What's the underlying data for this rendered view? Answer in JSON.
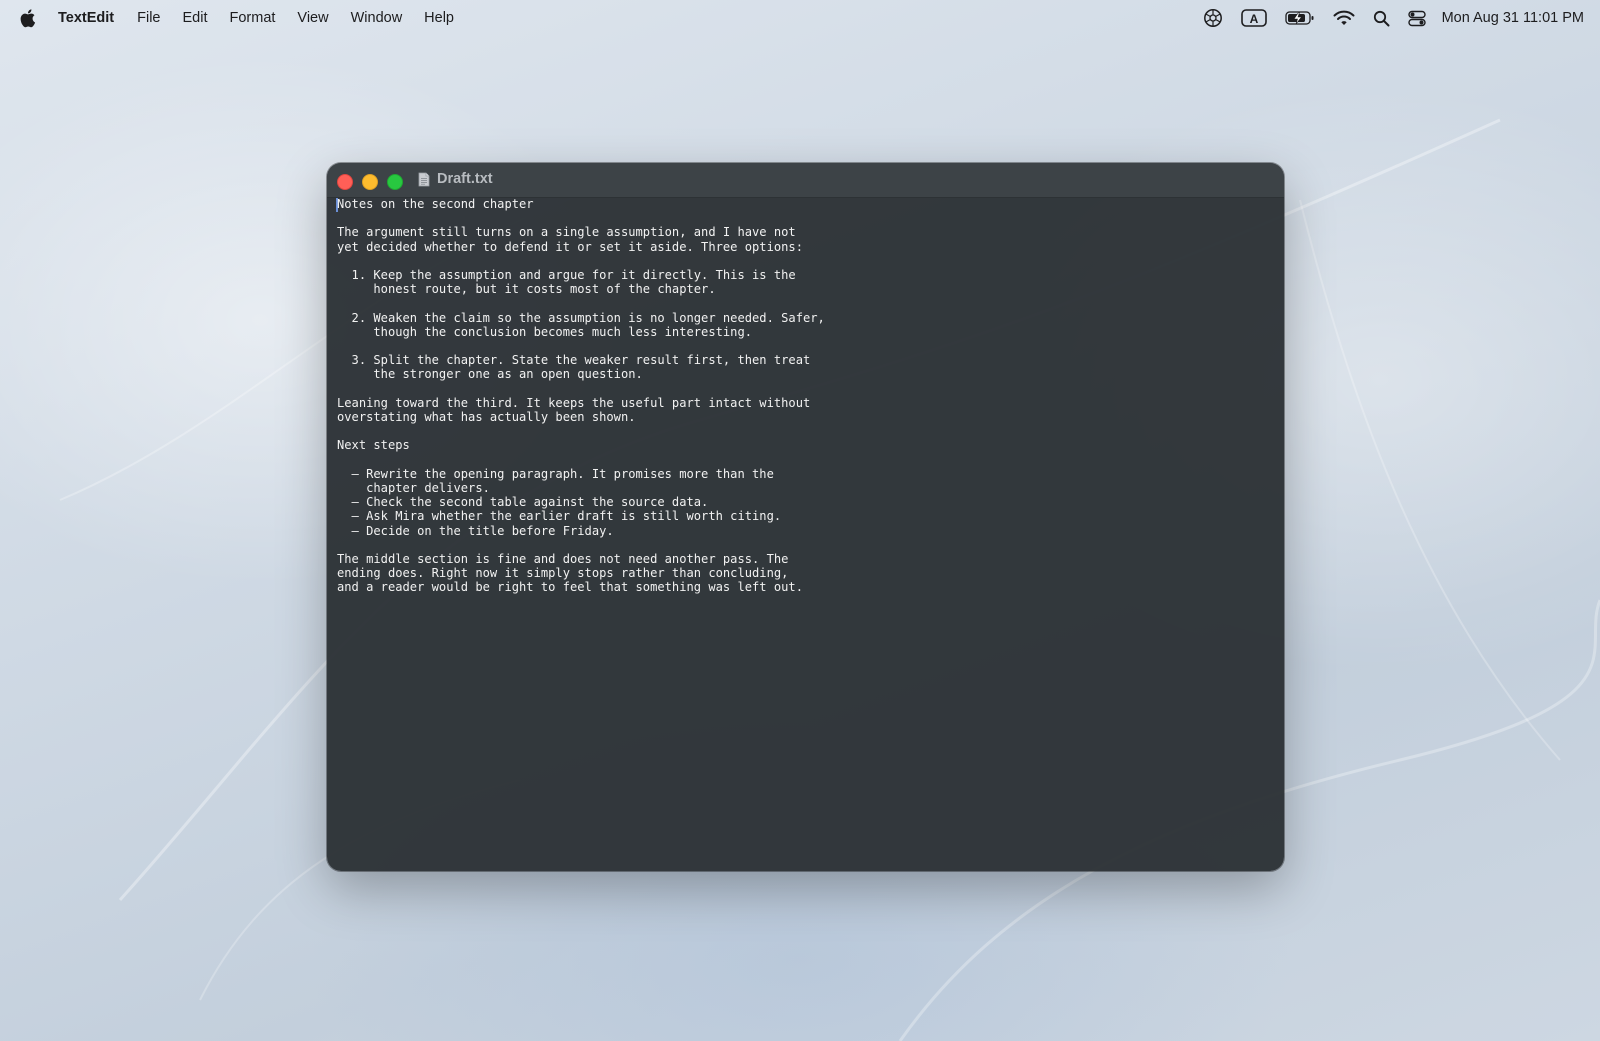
{
  "menubar": {
    "app_name": "TextEdit",
    "items": [
      "File",
      "Edit",
      "Format",
      "View",
      "Window",
      "Help"
    ],
    "status_icons": [
      "accessibility-icon",
      "input-source-icon",
      "battery-charging-icon",
      "wifi-icon",
      "spotlight-search-icon",
      "control-center-icon"
    ],
    "input_source_label": "A",
    "clock": "Mon Aug 31  11:01 PM"
  },
  "window": {
    "title": "Draft.txt",
    "document_icon": "document-icon",
    "traffic_light_colors": {
      "close": "#ff5f57",
      "minimize": "#febc2e",
      "zoom": "#28c840"
    },
    "text": "Notes on the second chapter\n\nThe argument still turns on a single assumption, and I have not\nyet decided whether to defend it or set it aside. Three options:\n\n  1. Keep the assumption and argue for it directly. This is the\n     honest route, but it costs most of the chapter.\n\n  2. Weaken the claim so the assumption is no longer needed. Safer,\n     though the conclusion becomes much less interesting.\n\n  3. Split the chapter. State the weaker result first, then treat\n     the stronger one as an open question.\n\nLeaning toward the third. It keeps the useful part intact without\noverstating what has actually been shown.\n\nNext steps\n\n  – Rewrite the opening paragraph. It promises more than the\n    chapter delivers.\n  – Check the second table against the source data.\n  – Ask Mira whether the earlier draft is still worth citing.\n  – Decide on the title before Friday.\n\nThe middle section is fine and does not need another pass. The\nending does. Right now it simply stops rather than concluding,\nand a reader would be right to feel that something was left out."
  }
}
